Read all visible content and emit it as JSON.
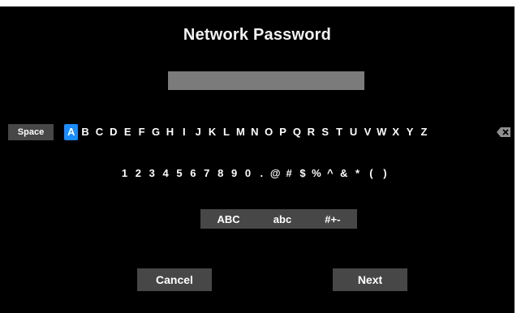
{
  "dialog": {
    "title": "Network Password"
  },
  "password_field": {
    "value": ""
  },
  "keyboard": {
    "space_label": "Space",
    "letters": [
      "A",
      "B",
      "C",
      "D",
      "E",
      "F",
      "G",
      "H",
      "I",
      "J",
      "K",
      "L",
      "M",
      "N",
      "O",
      "P",
      "Q",
      "R",
      "S",
      "T",
      "U",
      "V",
      "W",
      "X",
      "Y",
      "Z"
    ],
    "selected_key": "A",
    "selected_color": "#1a8cff",
    "backspace_icon": "backspace-icon",
    "symbols": [
      "1",
      "2",
      "3",
      "4",
      "5",
      "6",
      "7",
      "8",
      "9",
      "0",
      ".",
      "@",
      "#",
      "$",
      "%",
      "^",
      "&",
      "*",
      "(",
      ")"
    ],
    "modes": [
      "ABC",
      "abc",
      "#+-"
    ]
  },
  "buttons": {
    "cancel_label": "Cancel",
    "next_label": "Next"
  }
}
